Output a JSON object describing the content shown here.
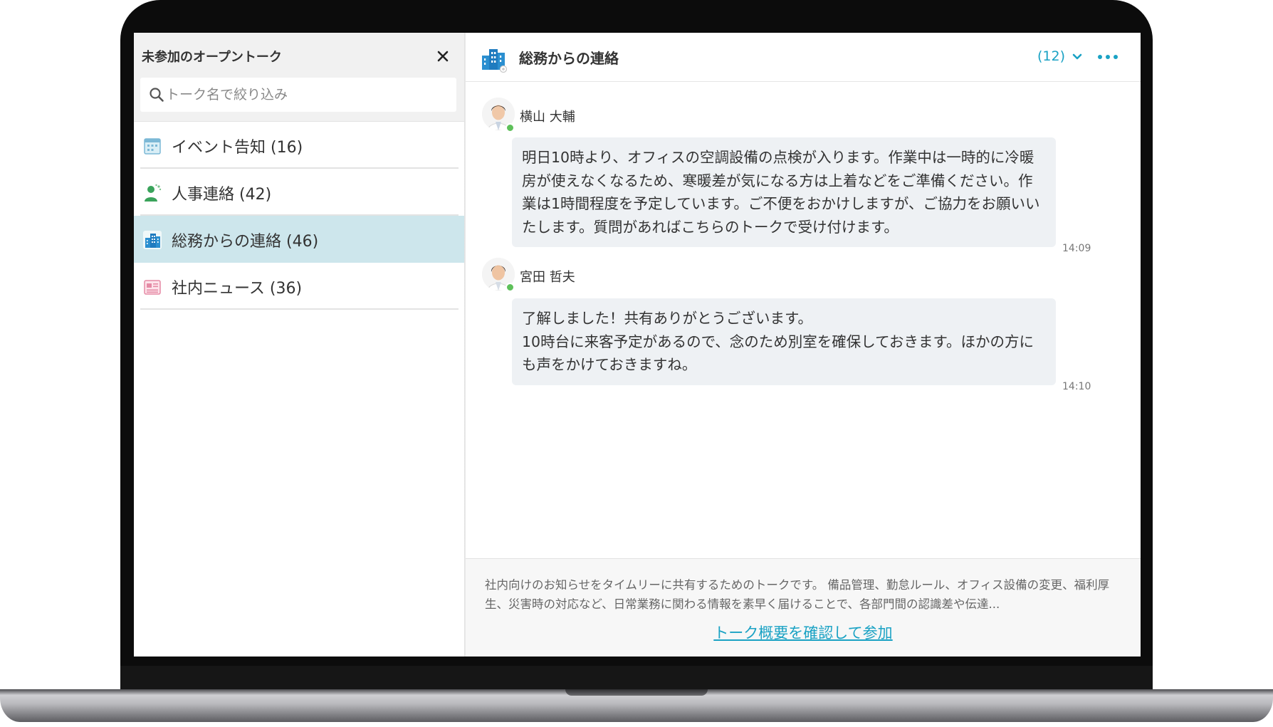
{
  "left_panel": {
    "title": "未参加のオープントーク",
    "close_icon": "close-icon",
    "search": {
      "placeholder": "トーク名で絞り込み",
      "value": ""
    },
    "talks": [
      {
        "label": "イベント告知 (16)",
        "icon": "calendar-icon",
        "active": false
      },
      {
        "label": "人事連絡 (42)",
        "icon": "person-icon",
        "active": false
      },
      {
        "label": "総務からの連絡 (46)",
        "icon": "building-icon",
        "active": true
      },
      {
        "label": "社内ニュース (36)",
        "icon": "newspaper-icon",
        "active": false
      }
    ]
  },
  "chat": {
    "room_title": "総務からの連絡",
    "member_count": "(12)",
    "messages": [
      {
        "sender": "横山 大輔",
        "text": "明日10時より、オフィスの空調設備の点検が入ります。作業中は一時的に冷暖房が使えなくなるため、寒暖差が気になる方は上着などをご準備ください。作業は1時間程度を予定しています。ご不便をおかけしますが、ご協力をお願いいたします。質問があればこちらのトークで受け付けます。",
        "time": "14:09"
      },
      {
        "sender": "宮田 哲夫",
        "text": "了解しました！共有ありがとうございます。\n10時台に来客予定があるので、念のため別室を確保しておきます。ほかの方にも声をかけておきますね。",
        "time": "14:10"
      }
    ],
    "footer": {
      "description": "社内向けのお知らせをタイムリーに共有するためのトークです。 備品管理、勤怠ルール、オフィス設備の変更、福利厚生、災害時の対応など、日常業務に関わる情報を素早く届けることで、各部門間の認識差や伝達...",
      "join_link": "トーク概要を確認して参加"
    }
  },
  "colors": {
    "accent": "#1aa2c4",
    "active_item": "#cde6ec",
    "bubble": "#eef1f4",
    "online": "#5ec05a"
  }
}
